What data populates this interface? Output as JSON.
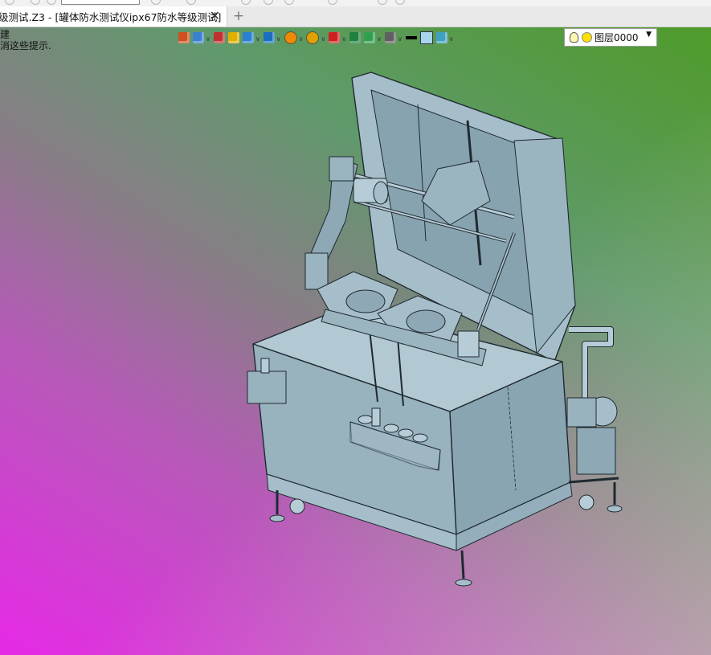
{
  "document_tab": {
    "title": "级测试.Z3 - [罐体防水测试仪ipx67防水等级测试]",
    "close_glyph": "✕"
  },
  "new_tab_glyph": "+",
  "hint_text": {
    "line1": "建",
    "line2": "消这些提示."
  },
  "toolbar": {
    "icons": [
      {
        "name": "view-arrow-icon",
        "color": "#d05020",
        "caret": false
      },
      {
        "name": "light-icon",
        "color": "#3a80d0",
        "caret": true
      },
      {
        "name": "pen-icon",
        "color": "#c03030",
        "caret": false
      },
      {
        "name": "shade-icon",
        "color": "#e0b000",
        "caret": false
      },
      {
        "name": "cube-icon",
        "color": "#2a80d0",
        "caret": true
      },
      {
        "name": "view-cube-icon",
        "color": "#1a70c0",
        "caret": true
      },
      {
        "name": "render-icon",
        "color": "#f08a00",
        "caret": true
      },
      {
        "name": "zoom-icon",
        "color": "#e0a000",
        "caret": true
      },
      {
        "name": "axis-icon",
        "color": "#d02020",
        "caret": true
      },
      {
        "name": "fit-icon",
        "color": "#208040",
        "caret": false
      },
      {
        "name": "section-icon",
        "color": "#30a050",
        "caret": true
      },
      {
        "name": "display-icon",
        "color": "#606060",
        "caret": true
      },
      {
        "name": "line-color-icon",
        "color": "#000000",
        "caret": false
      },
      {
        "name": "fill-color-icon",
        "color": "#a8d4ec",
        "caret": false
      },
      {
        "name": "layer-stack-icon",
        "color": "#40a0c0",
        "caret": true
      }
    ]
  },
  "layer_select": {
    "value": "图层0000",
    "dropdown_glyph": "▼"
  },
  "colors": {
    "model_fill": "#98b2be",
    "model_fill_light": "#b6ccd6",
    "model_fill_dark": "#7e98a4",
    "model_edge": "#1f2a30"
  }
}
